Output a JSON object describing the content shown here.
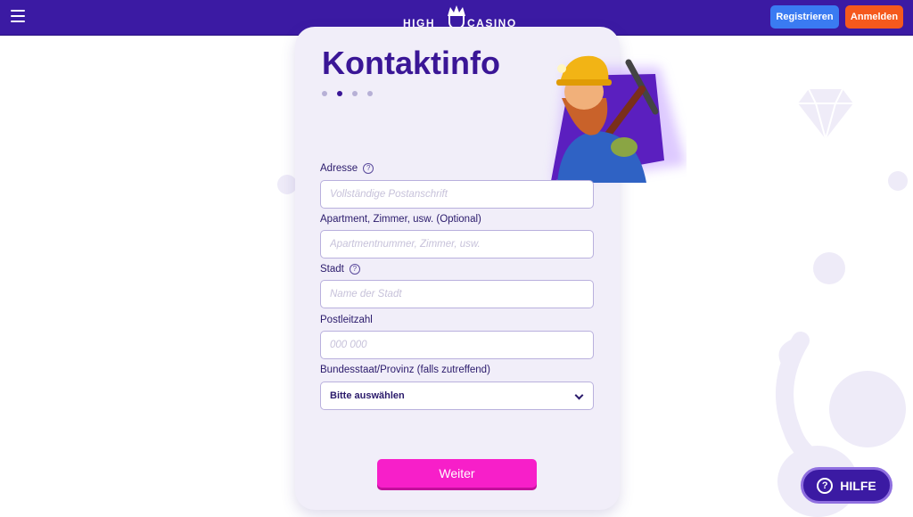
{
  "header": {
    "logo_left": "HIGH",
    "logo_right": "CASINO",
    "register_label": "Registrieren",
    "login_label": "Anmelden"
  },
  "form": {
    "title": "Kontaktinfo",
    "steps": {
      "total": 4,
      "active": 2
    },
    "fields": {
      "address": {
        "label": "Adresse",
        "placeholder": "Vollständige Postanschrift"
      },
      "apartment": {
        "label": "Apartment, Zimmer, usw. (Optional)",
        "placeholder": "Apartmentnummer, Zimmer, usw."
      },
      "city": {
        "label": "Stadt",
        "placeholder": "Name der Stadt"
      },
      "zip": {
        "label": "Postleitzahl",
        "placeholder": "000 000"
      },
      "state": {
        "label": "Bundesstaat/Provinz (falls zutreffend)",
        "value": "Bitte auswählen"
      }
    },
    "next_label": "Weiter"
  },
  "help": {
    "label": "HILFE"
  },
  "colors": {
    "header_bg": "#3b1aa3",
    "register": "#3a7bf2",
    "login": "#f5591d",
    "next": "#f71fc9",
    "title": "#3a1696"
  }
}
